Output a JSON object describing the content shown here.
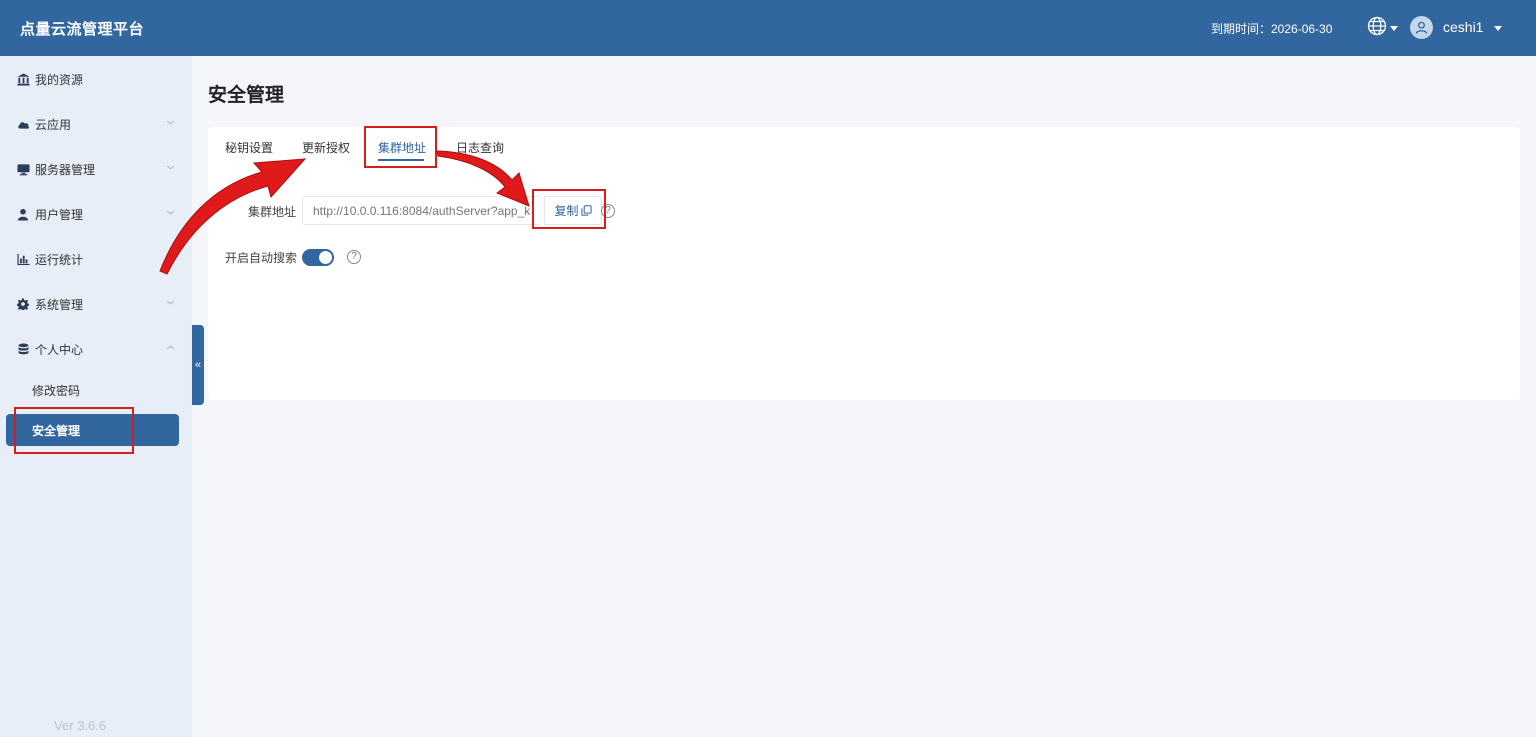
{
  "header": {
    "app_title": "点量云流管理平台",
    "expire_text": "到期时间：2026-06-30",
    "username": "ceshi1"
  },
  "sidebar": {
    "items": [
      {
        "label": "我的资源",
        "icon": "bank-icon"
      },
      {
        "label": "云应用",
        "icon": "cloud-icon"
      },
      {
        "label": "服务器管理",
        "icon": "monitor-icon"
      },
      {
        "label": "用户管理",
        "icon": "user-icon"
      },
      {
        "label": "运行统计",
        "icon": "bar-chart-icon"
      },
      {
        "label": "系统管理",
        "icon": "gear-icon"
      },
      {
        "label": "个人中心",
        "icon": "database-icon"
      }
    ],
    "sub_items": [
      {
        "label": "修改密码"
      },
      {
        "label": "安全管理",
        "active": true
      }
    ],
    "version": "Ver 3.6.6",
    "collapse_label": "«"
  },
  "page": {
    "title": "安全管理",
    "tabs": [
      {
        "label": "秘钥设置"
      },
      {
        "label": "更新授权"
      },
      {
        "label": "集群地址",
        "active": true
      },
      {
        "label": "日志查询"
      }
    ],
    "cluster": {
      "label": "集群地址",
      "value": "http://10.0.0.116:8084/authServer?app_k",
      "copy_label": "复制"
    },
    "auto_search": {
      "label": "开启自动搜索",
      "enabled": true
    },
    "help_glyph": "?"
  },
  "colors": {
    "primary": "#31669f",
    "sidebar_bg": "#e8eef8",
    "page_bg": "#f4f6fa",
    "annotation_red": "#d41f1f"
  }
}
